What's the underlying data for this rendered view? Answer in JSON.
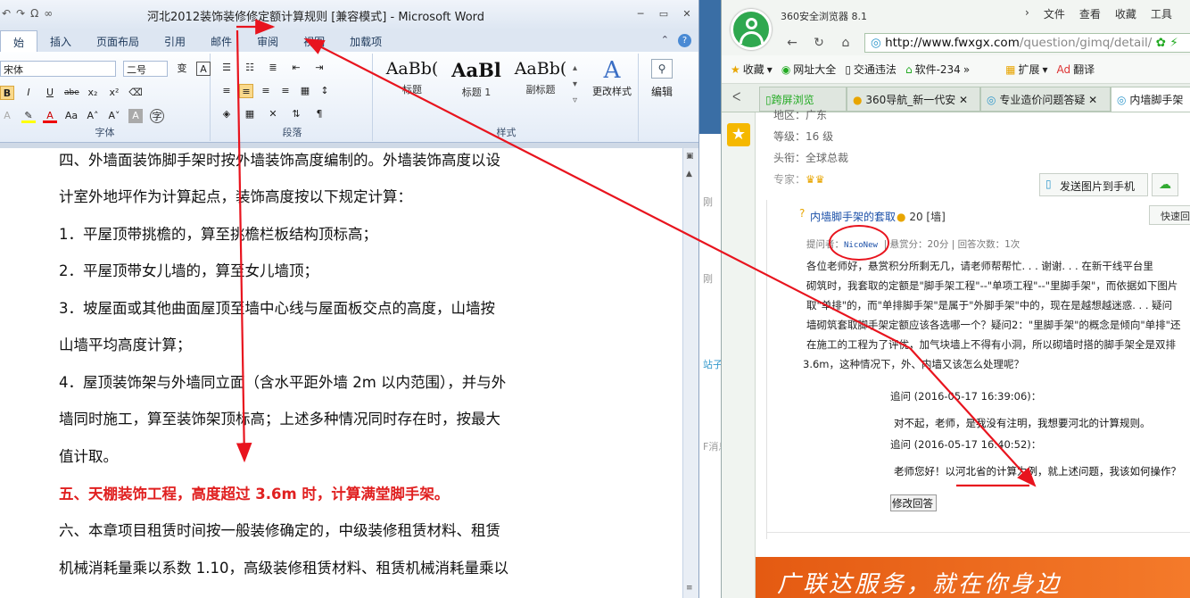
{
  "word": {
    "title": "河北2012装饰装修修定额计算规则 [兼容模式] - Microsoft Word",
    "tabs": [
      "始",
      "插入",
      "页面布局",
      "引用",
      "邮件",
      "审阅",
      "视图",
      "加载项"
    ],
    "font_name": "宋体",
    "font_size": "二号",
    "groups": {
      "font": "字体",
      "paragraph": "段落",
      "styles": "样式"
    },
    "styles": [
      {
        "sample": "AaBb(",
        "name": "标题"
      },
      {
        "sample": "AaBl",
        "name": "标题 1"
      },
      {
        "sample": "AaBb(",
        "name": "副标题"
      }
    ],
    "change_styles": "更改样式",
    "edit": "编辑",
    "doc_lines": [
      "四、外墙面装饰脚手架时按外墙装饰高度编制的。外墙装饰高度以设",
      "计室外地坪作为计算起点，装饰高度按以下规定计算：",
      "1．平屋顶带挑檐的，算至挑檐栏板结构顶标高；",
      "2．平屋顶带女儿墙的，算至女儿墙顶；",
      "3．坡屋面或其他曲面屋顶至墙中心线与屋面板交点的高度，山墙按",
      "山墙平均高度计算；",
      "4．屋顶装饰架与外墙同立面（含水平距外墙 2m 以内范围），并与外",
      "墙同时施工，算至装饰架顶标高；上述多种情况同时存在时，按最大",
      "值计取。",
      "五、天棚装饰工程，高度超过 3.6m 时，计算满堂脚手架。",
      "六、本章项目租赁时间按一般装修确定的，中级装修租赁材料、租赁",
      "机械消耗量乘以系数 1.10，高级装修租赁材料、租赁机械消耗量乘以"
    ],
    "highlight_line_index": 9
  },
  "middle": {
    "labels": [
      "刚",
      "刚",
      "站子",
      "F消息"
    ]
  },
  "browser": {
    "name": "360安全浏览器 8.1",
    "menu": [
      "文件",
      "查看",
      "收藏",
      "工具"
    ],
    "url_domain": "http://www.fwxgx.com",
    "url_rest": "/question/gimq/detail/",
    "favorites": [
      "收藏",
      "网址大全",
      "交通违法",
      "软件-234",
      "扩展",
      "翻译"
    ],
    "tabs": [
      "跨屏浏览",
      "360导航_新一代安",
      "专业造价问题答疑",
      "内墙脚手架"
    ],
    "profile": {
      "region": "地区：广东",
      "level": "等级：16 级",
      "title": "头衔：全球总裁",
      "expert": "专家："
    },
    "send_button": "发送图片到手机",
    "question": {
      "title": "内墙脚手架的套取",
      "score": "20",
      "score_tag": "[墙]",
      "quick_reply": "快速回",
      "asker_label": "提问者：",
      "asker": "NicoNew",
      "reward": "悬赏分：20分",
      "answer_count": "回答次数：1次",
      "body": [
        "各位老师好，悬赏积分所剩无几，请老师帮帮忙. . . 谢谢. . . 在新干线平台里",
        "砌筑时，我套取的定额是\"脚手架工程\"--\"单项工程\"--\"里脚手架\"，而依据如下图片",
        "取\"单排\"的，而\"单排脚手架\"是属于\"外脚手架\"中的，现在是越想越迷惑. . . 疑问",
        "墙砌筑套取脚手架定额应该各选哪一个？疑问2：\"里脚手架\"的概念是倾向\"单排\"还",
        "在施工的工程为了评优，加气块墙上不得有小洞，所以砌墙时搭的脚手架全是双排",
        "3.6m，这种情况下，外、内墙又该怎么处理呢？"
      ],
      "followups": [
        {
          "time": "追问 (2016-05-17 16:39:06)：",
          "text": "对不起，老师，是我没有注明，我想要河北的计算规则。"
        },
        {
          "time": "追问 (2016-05-17 16:40:52)：",
          "text": "老师您好！以河北省的计算为例，就上述问题，我该如何操作？"
        }
      ],
      "edit_answer": "修改回答"
    },
    "ad_text": "广联达服务，就在你身边"
  },
  "colors": {
    "accent_red": "#e02020",
    "arrow_red": "#e8141e",
    "browser_green": "#2fa84f",
    "link_blue": "#1a4fa8"
  }
}
